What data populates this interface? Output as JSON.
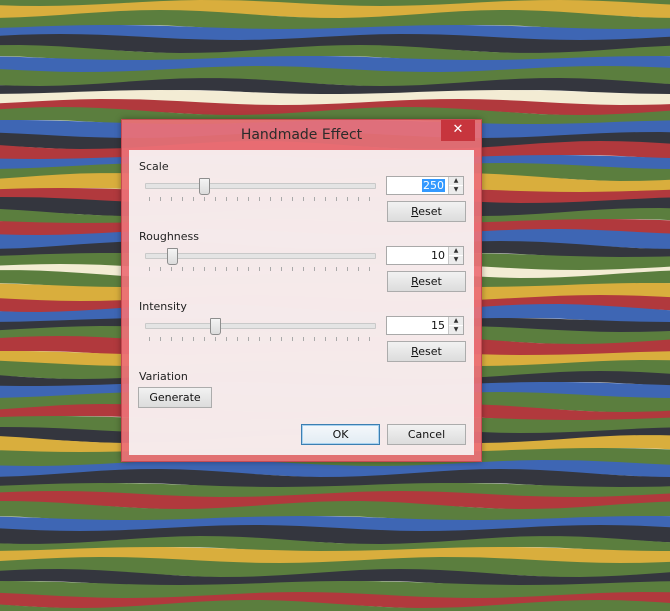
{
  "window": {
    "title": "Handmade Effect",
    "close_icon": "close-icon"
  },
  "controls": [
    {
      "label": "Scale",
      "value": "250",
      "value_selected": true,
      "min": 0,
      "max": 1000,
      "reset_label": "Reset",
      "reset_accel": "R"
    },
    {
      "label": "Roughness",
      "value": "10",
      "value_selected": false,
      "min": 0,
      "max": 100,
      "reset_label": "Reset",
      "reset_accel": "R"
    },
    {
      "label": "Intensity",
      "value": "15",
      "value_selected": false,
      "min": 0,
      "max": 50,
      "reset_label": "Reset",
      "reset_accel": "R"
    }
  ],
  "variation": {
    "label": "Variation",
    "generate_label": "Generate"
  },
  "footer": {
    "ok_label": "OK",
    "cancel_label": "Cancel"
  },
  "colors": {
    "stripes": [
      "#5b7e3e",
      "#34363e",
      "#3e66b4",
      "#b1393d",
      "#d9ae3d",
      "#f3ecd4"
    ],
    "dialog_frame": "#ec7076",
    "close_button": "#c7353d",
    "selection": "#3399ff"
  }
}
